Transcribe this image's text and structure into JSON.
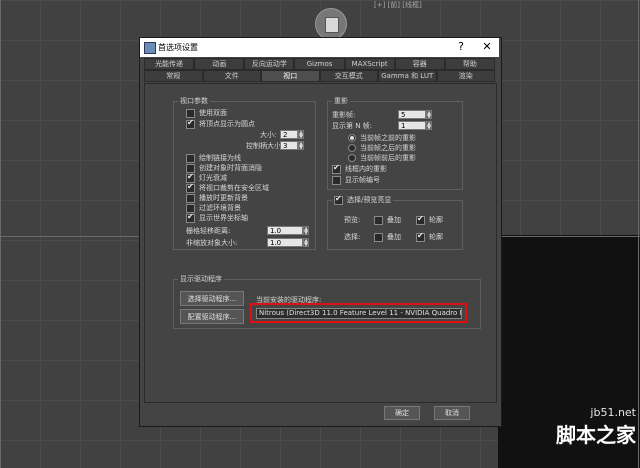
{
  "viewport": {
    "label": "[+] [前] [线框]",
    "watermark_url": "jb51.net",
    "watermark_text": "脚本之家"
  },
  "dialog": {
    "title": "首选项设置",
    "help_button": "?",
    "close_button": "✕",
    "tabs_row1": [
      "光能传递",
      "动画",
      "反向运动学",
      "Gizmos",
      "MAXScript",
      "容器",
      "帮助"
    ],
    "tabs_row2": [
      "常规",
      "文件",
      "视口",
      "交互模式",
      "Gamma 和 LUT",
      "渲染"
    ],
    "active_tab": "视口"
  },
  "viewport_params": {
    "title": "视口参数",
    "items": [
      {
        "label": "使用双面",
        "checked": false
      },
      {
        "label": "将顶点显示为圆点",
        "checked": true
      },
      {
        "label": "绘制链接为线",
        "checked": false
      },
      {
        "label": "创建对象时背面消隐",
        "checked": false
      },
      {
        "label": "灯光衰减",
        "checked": true
      },
      {
        "label": "将视口裁剪在安全区域",
        "checked": true
      },
      {
        "label": "播放时更新背景",
        "checked": false
      },
      {
        "label": "过滤环境背景",
        "checked": false
      },
      {
        "label": "显示世界坐标轴",
        "checked": true
      }
    ],
    "size_label": "大小:",
    "size_value": "2",
    "handle_size_label": "控制柄大小:",
    "handle_size_value": "3",
    "grid_nudge_label": "栅格轻移距离:",
    "grid_nudge_value": "1.0",
    "non_scale_label": "非缩放对象大小:",
    "non_scale_value": "1.0"
  },
  "ghosting": {
    "title": "重影",
    "frames_label": "重影帧:",
    "frames_value": "5",
    "nth_label": "显示第 N 帧:",
    "nth_value": "1",
    "options": [
      {
        "label": "当前帧之前的重影",
        "selected": true
      },
      {
        "label": "当前帧之后的重影",
        "selected": false
      },
      {
        "label": "当前帧前后的重影",
        "selected": false
      }
    ],
    "checks": [
      {
        "label": "线框内的重影",
        "checked": true
      },
      {
        "label": "显示帧编号",
        "checked": false
      }
    ]
  },
  "selection": {
    "title": "选择/预览亮显",
    "title_checked": true,
    "preview_label": "预览:",
    "select_label": "选择:",
    "overlay_label": "叠加",
    "outline_label": "轮廓",
    "preview_overlay": false,
    "preview_outline": true,
    "select_overlay": false,
    "select_outline": true
  },
  "display_driver": {
    "title": "显示驱动程序",
    "choose_button": "选择驱动程序...",
    "config_button": "配置驱动程序...",
    "current_label": "当前安装的驱动程序:",
    "current_value": "Nitrous (Direct3D 11.0 Feature Level 11 - NVIDIA Quadro M500M)"
  },
  "footer": {
    "ok": "确定",
    "cancel": "取消"
  },
  "colors": {
    "highlight": "#e01010",
    "dialog_bg": "#444444"
  }
}
